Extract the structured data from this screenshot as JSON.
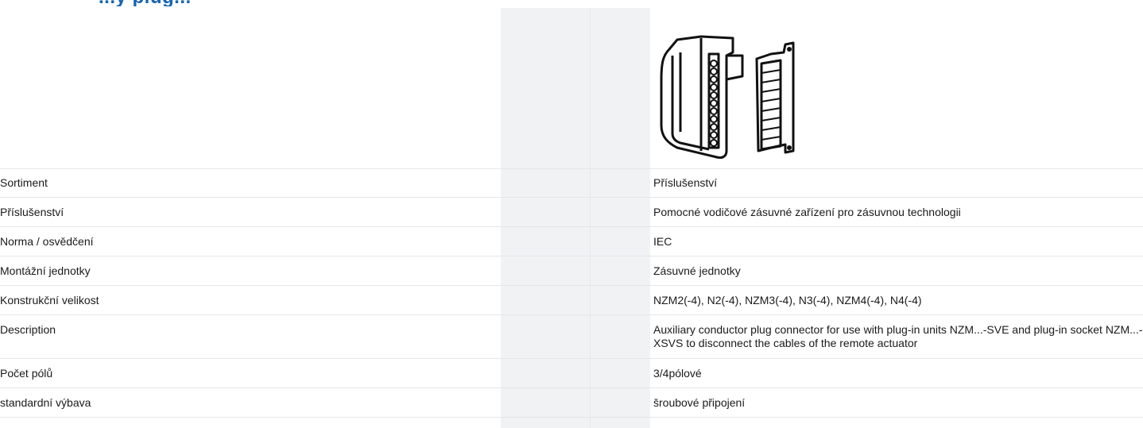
{
  "header": {
    "title": "...y plug..."
  },
  "product_image": {
    "icon": "plug-connector-icon"
  },
  "properties": [
    {
      "label": "Sortiment",
      "value": "Příslušenství"
    },
    {
      "label": "Příslušenství",
      "value": "Pomocné vodičové zásuvné zařízení pro zásuvnou technologii"
    },
    {
      "label": "Norma / osvědčení",
      "value": "IEC"
    },
    {
      "label": "Montážní jednotky",
      "value": "Zásuvné jednotky"
    },
    {
      "label": "Konstrukční velikost",
      "value": "NZM2(-4), N2(-4), NZM3(-4), N3(-4), NZM4(-4), N4(-4)"
    },
    {
      "label": "Description",
      "value": "Auxiliary conductor plug connector for use with plug-in units NZM...-SVE and plug-in socket NZM...-XSVS to disconnect the cables of the remote actuator"
    },
    {
      "label": "Počet pólů",
      "value": "3/4pólové"
    },
    {
      "label": "standardní výbava",
      "value": "šroubové připojení"
    }
  ]
}
